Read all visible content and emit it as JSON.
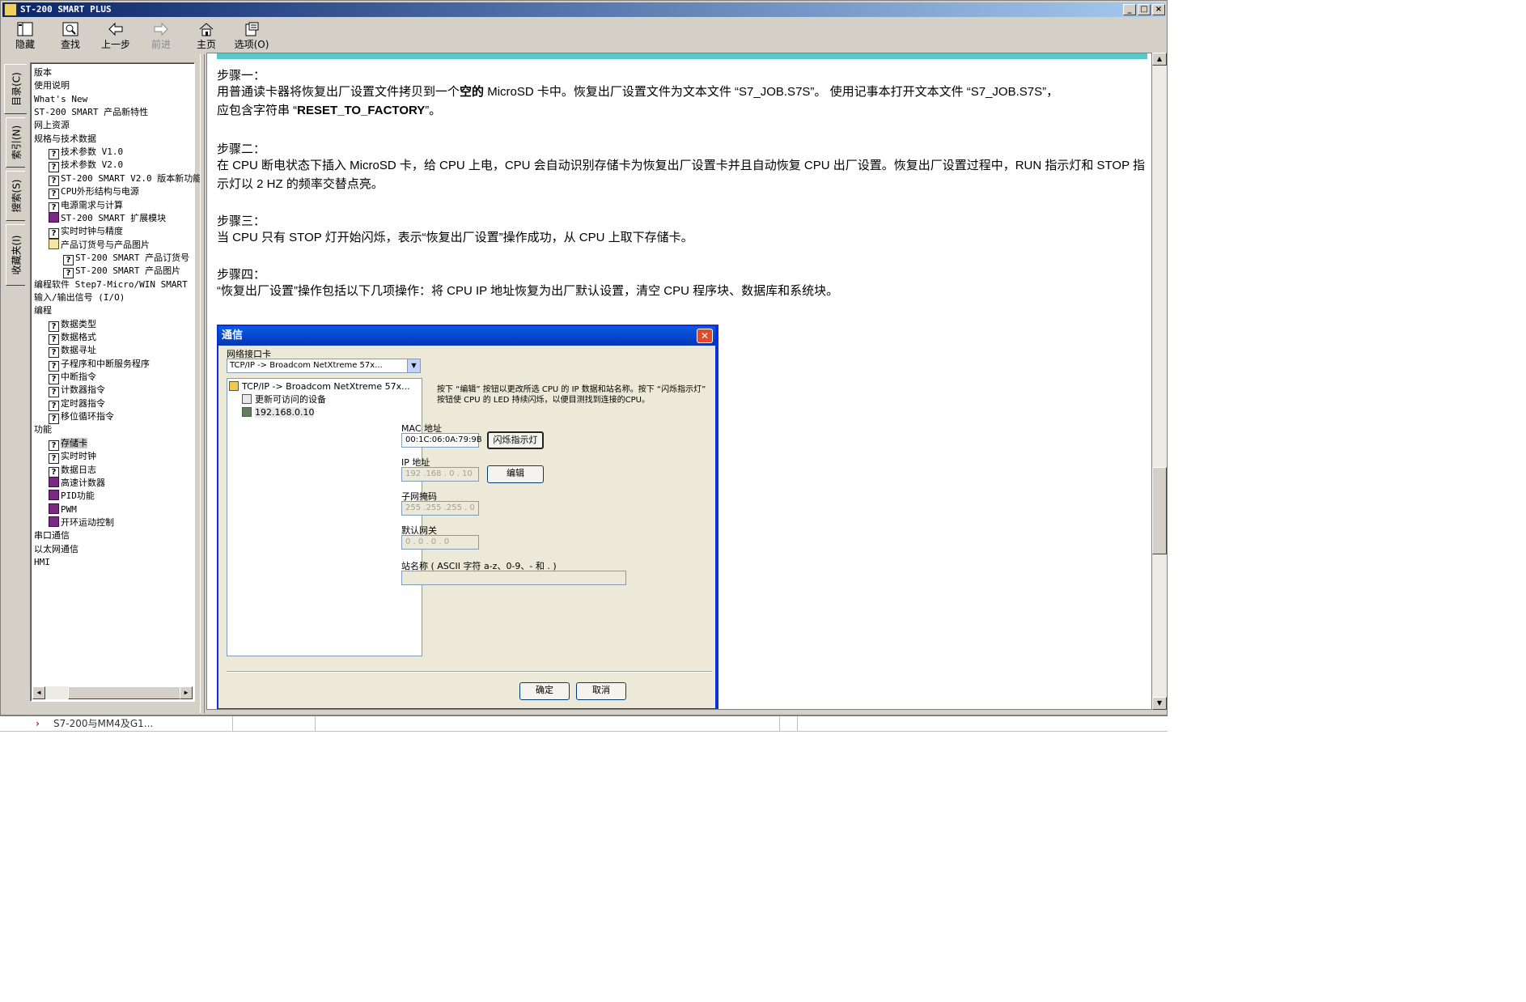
{
  "window": {
    "title": "ST-200 SMART PLUS",
    "caption_buttons": {
      "minimize": "_",
      "maximize": "□",
      "close": "×"
    }
  },
  "toolbar": {
    "hide": "隐藏",
    "find": "查找",
    "back": "上一步",
    "forward": "前进",
    "home": "主页",
    "options": "选项(O)"
  },
  "nav_tabs": [
    "目录(C)",
    "索引(N)",
    "搜索(S)",
    "收藏夹(I)"
  ],
  "tree": [
    {
      "label": "版本",
      "icon": "none",
      "indent": 0
    },
    {
      "label": "使用说明",
      "icon": "none",
      "indent": 0
    },
    {
      "label": "What's New",
      "icon": "none",
      "indent": 0
    },
    {
      "label": "ST-200 SMART 产品新特性",
      "icon": "none",
      "indent": 0
    },
    {
      "label": "网上资源",
      "icon": "none",
      "indent": 0
    },
    {
      "label": "规格与技术数据",
      "icon": "none",
      "indent": 0
    },
    {
      "label": "技术参数 V1.0",
      "icon": "help",
      "indent": 1
    },
    {
      "label": "技术参数 V2.0",
      "icon": "help",
      "indent": 1
    },
    {
      "label": "ST-200 SMART V2.0 版本新功能",
      "icon": "help",
      "indent": 1
    },
    {
      "label": "CPU外形结构与电源",
      "icon": "help",
      "indent": 1
    },
    {
      "label": "电源需求与计算",
      "icon": "help",
      "indent": 1
    },
    {
      "label": "ST-200 SMART 扩展模块",
      "icon": "book",
      "indent": 1
    },
    {
      "label": "实时时钟与精度",
      "icon": "help",
      "indent": 1
    },
    {
      "label": "产品订货号与产品图片",
      "icon": "open",
      "indent": 1
    },
    {
      "label": "ST-200 SMART 产品订货号",
      "icon": "help",
      "indent": 2
    },
    {
      "label": "ST-200 SMART 产品图片",
      "icon": "help",
      "indent": 2
    },
    {
      "label": "编程软件 Step7-Micro/WIN SMART",
      "icon": "none",
      "indent": 0
    },
    {
      "label": "输入/输出信号 (I/O)",
      "icon": "none",
      "indent": 0
    },
    {
      "label": "编程",
      "icon": "none",
      "indent": 0
    },
    {
      "label": "数据类型",
      "icon": "help",
      "indent": 1
    },
    {
      "label": "数据格式",
      "icon": "help",
      "indent": 1
    },
    {
      "label": "数据寻址",
      "icon": "help",
      "indent": 1
    },
    {
      "label": "子程序和中断服务程序",
      "icon": "help",
      "indent": 1
    },
    {
      "label": "中断指令",
      "icon": "help",
      "indent": 1
    },
    {
      "label": "计数器指令",
      "icon": "help",
      "indent": 1
    },
    {
      "label": "定时器指令",
      "icon": "help",
      "indent": 1
    },
    {
      "label": "移位循环指令",
      "icon": "help",
      "indent": 1
    },
    {
      "label": "功能",
      "icon": "none",
      "indent": 0
    },
    {
      "label": "存储卡",
      "icon": "help",
      "indent": 1,
      "selected": true
    },
    {
      "label": "实时时钟",
      "icon": "help",
      "indent": 1
    },
    {
      "label": "数据日志",
      "icon": "help",
      "indent": 1
    },
    {
      "label": "高速计数器",
      "icon": "book",
      "indent": 1
    },
    {
      "label": "PID功能",
      "icon": "book",
      "indent": 1
    },
    {
      "label": "PWM",
      "icon": "book",
      "indent": 1
    },
    {
      "label": "开环运动控制",
      "icon": "book",
      "indent": 1
    },
    {
      "label": "串口通信",
      "icon": "none",
      "indent": 0
    },
    {
      "label": "以太网通信",
      "icon": "none",
      "indent": 0
    },
    {
      "label": "HMI",
      "icon": "none",
      "indent": 0
    }
  ],
  "content": {
    "step1_title": "步骤一：",
    "step1_a": "用普通读卡器将恢复出厂设置文件拷贝到一个",
    "step1_b": "空的",
    "step1_c": " MicroSD 卡中。恢复出厂设置文件为文本文件 “S7_JOB.S7S”。 使用记事本打开文本文件 “S7_JOB.S7S”，",
    "step1_d": "应包含字符串 “",
    "step1_e": "RESET_TO_FACTORY",
    "step1_f": "”。",
    "step2_title": "步骤二：",
    "step2_text": "在 CPU 断电状态下插入 MicroSD 卡，给 CPU 上电，CPU 会自动识别存储卡为恢复出厂设置卡并且自动恢复 CPU 出厂设置。恢复出厂设置过程中，RUN 指示灯和 STOP 指示灯以 2 HZ 的频率交替点亮。",
    "step3_title": "步骤三：",
    "step3_text": "当 CPU 只有 STOP 灯开始闪烁，表示“恢复出厂设置”操作成功，从 CPU 上取下存储卡。",
    "step4_title": "步骤四：",
    "step4_text": "“恢复出厂设置”操作包括以下几项操作：将 CPU IP 地址恢复为出厂默认设置，清空 CPU 程序块、数据库和系统块。"
  },
  "dialog": {
    "title": "通信",
    "nic_label": "网络接口卡",
    "nic_value": "TCP/IP -> Broadcom NetXtreme 57x...",
    "tree_root": "TCP/IP -> Broadcom NetXtreme 57x...",
    "tree_refresh": "更新可访问的设备",
    "tree_device": "192.168.0.10",
    "hint": "按下 “编辑” 按钮以更改所选 CPU 的 IP 数据和站名称。按下 “闪烁指示灯” 按钮使 CPU 的 LED 持续闪烁，以便目测找到连接的CPU。",
    "mac_label": "MAC 地址",
    "mac_value": "00:1C:06:0A:79:9B",
    "blink_button": "闪烁指示灯",
    "ip_label": "IP 地址",
    "ip_value": "192 .168 . 0  . 10",
    "edit_button": "编辑",
    "subnet_label": "子网掩码",
    "subnet_value": "255 .255 .255 . 0",
    "gateway_label": "默认网关",
    "gateway_value": " 0  . 0  . 0  . 0",
    "station_label": "站名称 ( ASCII 字符 a-z、0-9、- 和 . )",
    "station_value": "",
    "ok_button": "确定",
    "cancel_button": "取消"
  },
  "status": {
    "item": "S7-200与MM4及G1..."
  }
}
